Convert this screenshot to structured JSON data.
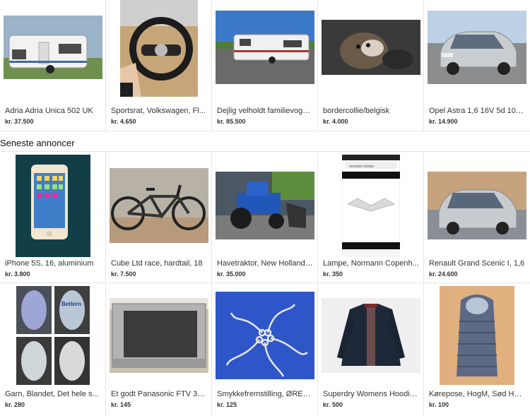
{
  "section_heading": "Seneste annoncer",
  "row1": [
    {
      "title": "Adria Adria Unica 502 UK",
      "price": "kr. 37.500",
      "icon": "caravan-photo"
    },
    {
      "title": "Sportsrat, Volkswagen, Fl...",
      "price": "kr. 4.650",
      "icon": "steering-wheel-photo"
    },
    {
      "title": "Dejlig velholdt familievogn...",
      "price": "kr. 85.500",
      "icon": "caravan-photo"
    },
    {
      "title": "bordercollie/belgisk",
      "price": "kr. 4.000",
      "icon": "puppy-photo"
    },
    {
      "title": "Opel Astra 1,6 16V 5d 100...",
      "price": "kr. 14.900",
      "icon": "car-photo"
    }
  ],
  "row2": [
    {
      "title": "iPhone 5S, 16, aluminium",
      "price": "kr. 3.800",
      "icon": "phone-photo"
    },
    {
      "title": "Cube Ltd race, hardtail, 18",
      "price": "kr. 7.500",
      "icon": "bicycle-photo"
    },
    {
      "title": "Havetraktor, New Holland, ...",
      "price": "kr. 35.000",
      "icon": "tractor-photo"
    },
    {
      "title": "Lampe, Normann Copenh...",
      "price": "kr. 350",
      "icon": "lamp-screenshot"
    },
    {
      "title": "Renault Grand Scenic I, 1,6",
      "price": "kr. 24.600",
      "icon": "car-photo"
    }
  ],
  "row3": [
    {
      "title": "Garn, Blandet, Det hele s...",
      "price": "kr. 280",
      "icon": "yarn-photo"
    },
    {
      "title": "Et godt Panasonic FTV 32...",
      "price": "kr. 145",
      "icon": "tv-photo"
    },
    {
      "title": "Smykkefremstilling, ØREK...",
      "price": "kr. 125",
      "icon": "earring-hooks-photo"
    },
    {
      "title": "Superdry Womens Hoodie...",
      "price": "kr. 500",
      "icon": "jacket-photo"
    },
    {
      "title": "Kørepose, HogM, Sød Helt...",
      "price": "kr. 100",
      "icon": "footmuff-photo"
    }
  ],
  "image_text": {
    "yarn_brand": "Bettern",
    "phone_search_query": "normann lampe"
  },
  "colors": {
    "text": "#333333",
    "divider": "#e6e6e6",
    "earring_bg": "#2f56c8"
  }
}
